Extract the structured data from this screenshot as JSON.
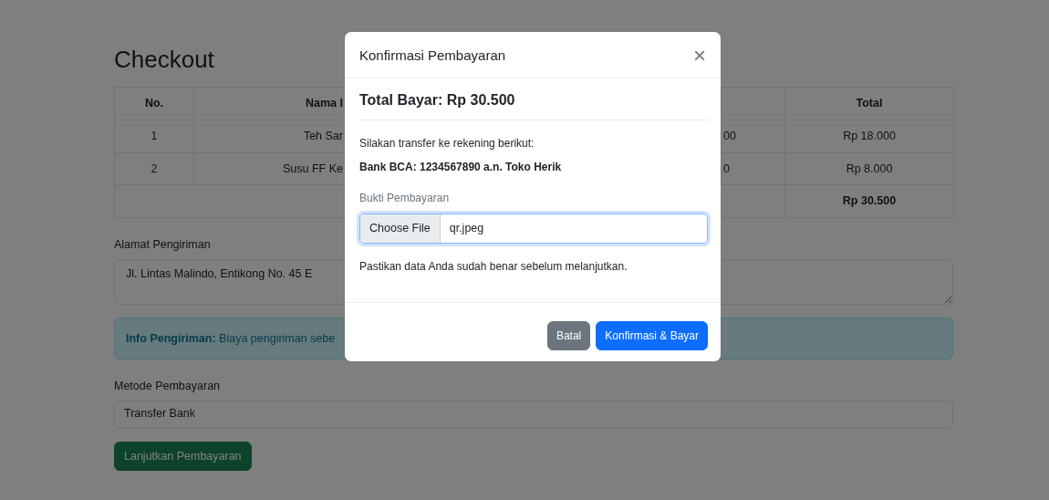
{
  "page": {
    "title": "Checkout",
    "table": {
      "columns": [
        "No.",
        "Nama I",
        "Total"
      ],
      "rows": [
        {
          "no": "1",
          "column_2": "Teh Sar",
          "column_3": "00",
          "total": "Rp 18.000"
        },
        {
          "no": "2",
          "column_2": "Susu FF Ke",
          "column_3": "0",
          "total": "Rp 8.000"
        }
      ],
      "grand_total": "Rp 30.500"
    },
    "address": {
      "label": "Alamat Pengiriman",
      "value": "Jl. Lintas Malindo, Entikong No. 45 E"
    },
    "alert": {
      "text": "**Info Pengiriman:** Biaya pengiriman sebe"
    },
    "payment_method": {
      "label": "Metode Pembayaran",
      "value": "Transfer Bank"
    },
    "continue_button": "Lanjutkan Pembayaran"
  },
  "modal": {
    "title": "Konfirmasi Pembayaran",
    "close": "×",
    "total": "Total Bayar: Rp 30.500",
    "instruction": "Silakan transfer ke rekening berikut:",
    "bank": "Bank BCA: 1234567890 a.n. Toko Herik",
    "file": {
      "label": "Bukti Pembayaran",
      "button": "Choose File",
      "value": "qr.jpeg",
      "focused": true
    },
    "note": "Pastikan data Anda sudah benar sebelum melanjutkan.",
    "buttons": [
      {
        "label": "Batal",
        "kind": "secondary"
      },
      {
        "label": "Konfirmasi & Bayar",
        "kind": "primary"
      }
    ]
  }
}
